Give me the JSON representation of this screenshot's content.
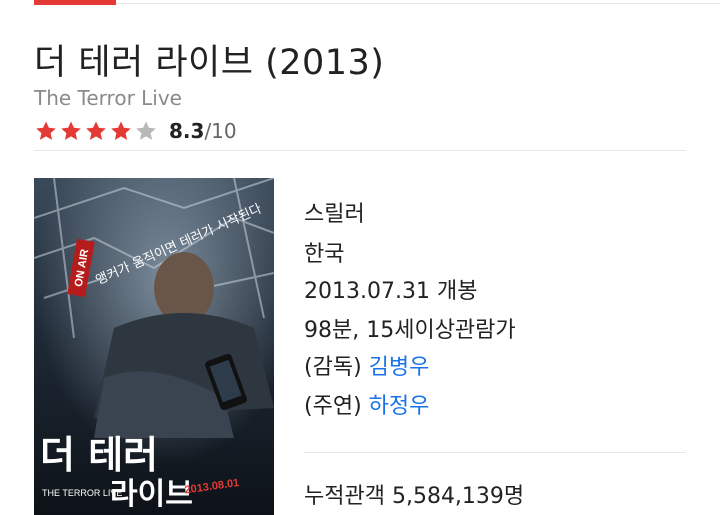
{
  "movie": {
    "title": "더 테러 라이브 (2013)",
    "original_title": "The Terror Live",
    "rating": {
      "score": "8.3",
      "max": "/10",
      "stars_filled": 4,
      "stars_total": 5
    },
    "genre": "스릴러",
    "country": "한국",
    "release": "2013.07.31 개봉",
    "runtime_rating": "98분, 15세이상관람가",
    "director": {
      "label": "(감독)",
      "name": "김병우"
    },
    "cast": {
      "label": "(주연)",
      "name": "하정우"
    },
    "box_office": "누적관객 5,584,139명"
  },
  "poster": {
    "tagline": "앵커가 움직이면 테러가 시작된다",
    "title_line1": "더 테러",
    "title_line2": "라이브",
    "small_text": "THE TERROR LIVE",
    "date": "2013.08.01",
    "badge": "ON AIR"
  },
  "colors": {
    "accent": "#e53935",
    "star_filled": "#e53935",
    "star_empty": "#b8b8b8",
    "link": "#1a73e8"
  }
}
